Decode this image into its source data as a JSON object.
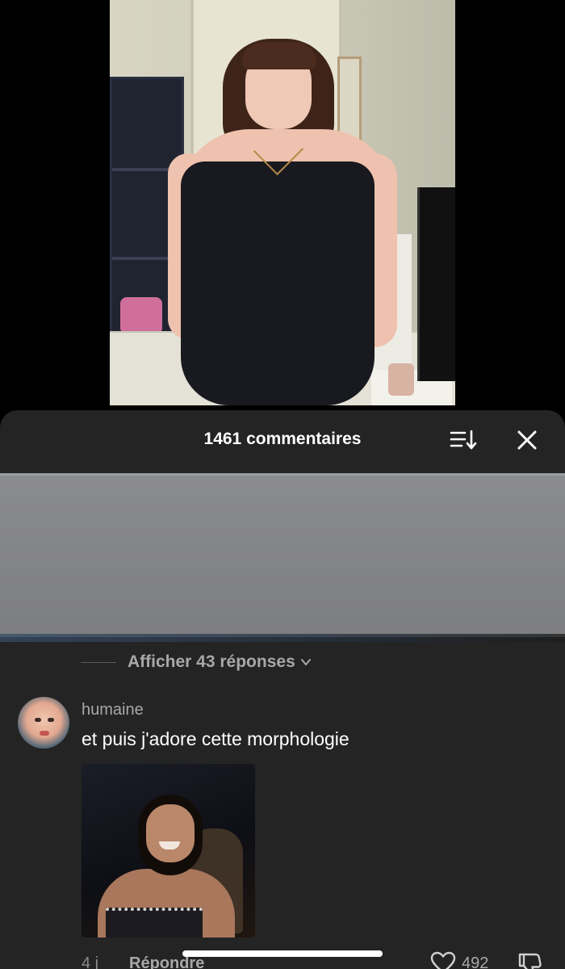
{
  "comments_panel": {
    "title": "1461 commentaires",
    "sort_icon": "sort-icon",
    "close_icon": "close-icon"
  },
  "thread": {
    "view_replies_label": "Afficher 43 réponses",
    "chevron_icon": "chevron-down-icon"
  },
  "comment": {
    "username": "humaine",
    "text": "et puis j'adore cette morphologie",
    "time": "4 j",
    "reply_label": "Répondre",
    "like_count": "492",
    "like_icon": "heart-icon",
    "dislike_icon": "dislike-icon"
  },
  "colors": {
    "panel_background": "#242424",
    "primary_text": "#ffffff",
    "secondary_text": "#a8a8a8",
    "redaction_gray": "#808183"
  }
}
